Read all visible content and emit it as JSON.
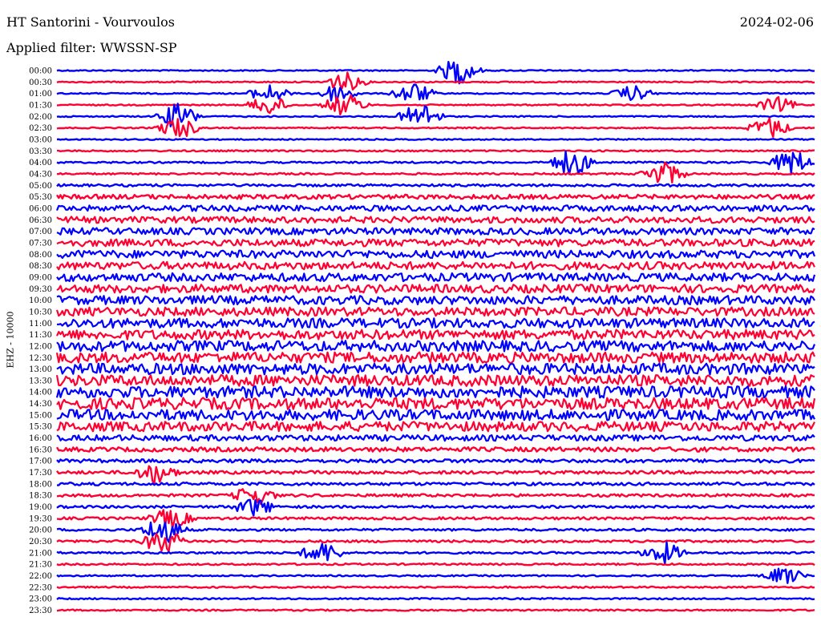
{
  "header": {
    "station": "HT Santorini - Vourvoulos",
    "date": "2024-02-06",
    "filter": "Applied filter: WWSSN-SP"
  },
  "chart_data": {
    "type": "line",
    "title": "HT Santorini - Vourvoulos",
    "ylabel": "EHZ - 10000",
    "colors": [
      "#0000ff",
      "#ff0033"
    ],
    "tick_labels": [
      "00:00",
      "00:30",
      "01:00",
      "01:30",
      "02:00",
      "02:30",
      "03:00",
      "03:30",
      "04:00",
      "04:30",
      "05:00",
      "05:30",
      "06:00",
      "06:30",
      "07:00",
      "07:30",
      "08:00",
      "08:30",
      "09:00",
      "09:30",
      "10:00",
      "10:30",
      "11:00",
      "11:30",
      "12:00",
      "12:30",
      "13:00",
      "13:30",
      "14:00",
      "14:30",
      "15:00",
      "15:30",
      "16:00",
      "16:30",
      "17:00",
      "17:30",
      "18:00",
      "18:30",
      "19:00",
      "19:30",
      "20:00",
      "20:30",
      "21:00",
      "21:30",
      "22:00",
      "22:30",
      "23:00",
      "23:30"
    ],
    "amplitude_level": [
      0.25,
      0.25,
      0.25,
      0.25,
      0.25,
      0.25,
      0.25,
      0.3,
      0.35,
      0.35,
      0.5,
      0.9,
      1.2,
      1.3,
      1.4,
      1.5,
      1.6,
      1.6,
      1.7,
      1.7,
      1.8,
      1.8,
      2.0,
      2.0,
      2.2,
      2.2,
      2.3,
      2.3,
      2.4,
      2.4,
      2.2,
      2.0,
      1.2,
      0.9,
      0.7,
      0.65,
      0.6,
      0.55,
      0.5,
      0.5,
      0.45,
      0.45,
      0.4,
      0.35,
      0.3,
      0.3,
      0.3,
      0.3
    ],
    "events": [
      {
        "row": 0,
        "t": 0.53,
        "amp": 2.5
      },
      {
        "row": 1,
        "t": 0.38,
        "amp": 1.8
      },
      {
        "row": 2,
        "t": 0.28,
        "amp": 1.6
      },
      {
        "row": 2,
        "t": 0.37,
        "amp": 1.8
      },
      {
        "row": 2,
        "t": 0.47,
        "amp": 2.0
      },
      {
        "row": 2,
        "t": 0.76,
        "amp": 1.4
      },
      {
        "row": 3,
        "t": 0.28,
        "amp": 1.8
      },
      {
        "row": 3,
        "t": 0.38,
        "amp": 2.2
      },
      {
        "row": 3,
        "t": 0.95,
        "amp": 1.4
      },
      {
        "row": 4,
        "t": 0.16,
        "amp": 2.4
      },
      {
        "row": 4,
        "t": 0.48,
        "amp": 2.6
      },
      {
        "row": 5,
        "t": 0.16,
        "amp": 2.0
      },
      {
        "row": 5,
        "t": 0.94,
        "amp": 2.0
      },
      {
        "row": 8,
        "t": 0.68,
        "amp": 2.6
      },
      {
        "row": 8,
        "t": 0.97,
        "amp": 2.4
      },
      {
        "row": 9,
        "t": 0.8,
        "amp": 2.4
      },
      {
        "row": 35,
        "t": 0.13,
        "amp": 1.8
      },
      {
        "row": 37,
        "t": 0.26,
        "amp": 1.8
      },
      {
        "row": 38,
        "t": 0.26,
        "amp": 1.6
      },
      {
        "row": 39,
        "t": 0.15,
        "amp": 1.8
      },
      {
        "row": 40,
        "t": 0.14,
        "amp": 2.6
      },
      {
        "row": 41,
        "t": 0.14,
        "amp": 2.2
      },
      {
        "row": 42,
        "t": 0.35,
        "amp": 2.0
      },
      {
        "row": 42,
        "t": 0.8,
        "amp": 2.0
      },
      {
        "row": 44,
        "t": 0.96,
        "amp": 1.6
      }
    ]
  }
}
